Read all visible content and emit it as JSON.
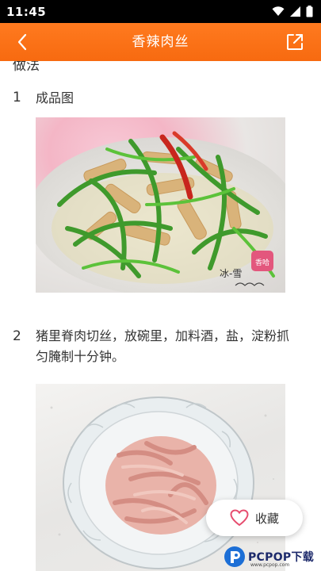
{
  "status_bar": {
    "time": "11:45"
  },
  "header": {
    "title": "香辣肉丝"
  },
  "method": {
    "heading": "做法"
  },
  "steps": [
    {
      "number": "1",
      "text": "成品图"
    },
    {
      "number": "2",
      "text": "猪里脊肉切丝，放碗里，加料酒，盐，淀粉抓匀腌制十分钟。"
    }
  ],
  "photo_1": {
    "watermark": "冰-雪",
    "badge": "香哈"
  },
  "favorite": {
    "label": "收藏"
  },
  "watermark": {
    "brand": "PCPOP下载",
    "sub": "www.pcpop.com"
  },
  "colors": {
    "header": "#f76a10",
    "status_bar": "#000000",
    "heart": "#e64d6f"
  }
}
